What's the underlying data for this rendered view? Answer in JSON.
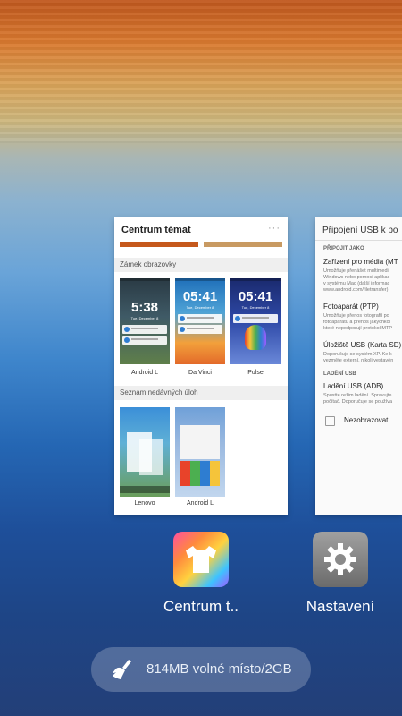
{
  "card_theme": {
    "title": "Centrum témat",
    "menu_icon": "more-dots-icon",
    "section_lock": "Zámek obrazovky",
    "lock_themes": [
      {
        "label": "Android L",
        "time": "5:38",
        "date": "Tue, December 8"
      },
      {
        "label": "Da Vinci",
        "time": "05:41",
        "date": "Tue, December 8"
      },
      {
        "label": "Pulse",
        "time": "05:41",
        "date": "Tue, December 8"
      }
    ],
    "section_recent": "Seznam nedávných úloh",
    "recent_themes": [
      {
        "label": "Lenovo"
      },
      {
        "label": "Android L"
      }
    ]
  },
  "card_usb": {
    "title": "Připojení USB k po",
    "section_connect": "PŘIPOJIT JAKO",
    "items": [
      {
        "title": "Zařízení pro média (MT",
        "desc": [
          "Umožňuje přenášet multimedi",
          "Windows nebo pomocí aplikac",
          "v systému Mac (další informac",
          "www.android.com/filetransfer)"
        ]
      },
      {
        "title": "Fotoaparát (PTP)",
        "desc": [
          "Umožňuje přenos fotografií po",
          "fotoaparátu a přenos jakýchkol",
          "které nepodporují protokol MTP"
        ]
      },
      {
        "title": "Úložiště USB (Karta SD)",
        "desc": [
          "Doporučuje se systém XP. Ke k",
          "vezměte externí, nikoli vestavěn"
        ]
      }
    ],
    "section_debug": "LADĚNÍ USB",
    "debug_item": {
      "title": "Ladění USB (ADB)",
      "desc": [
        "Spustte režim ladění. Spravujte",
        "počítač. Doporučuje se používa"
      ]
    },
    "checkbox_label": "Nezobrazovat"
  },
  "apps": [
    {
      "label": "Centrum t..",
      "icon": "tshirt-icon"
    },
    {
      "label": "Nastavení",
      "icon": "gear-icon"
    }
  ],
  "memory": {
    "text": "814MB volné místo/2GB",
    "icon": "broom-icon"
  }
}
